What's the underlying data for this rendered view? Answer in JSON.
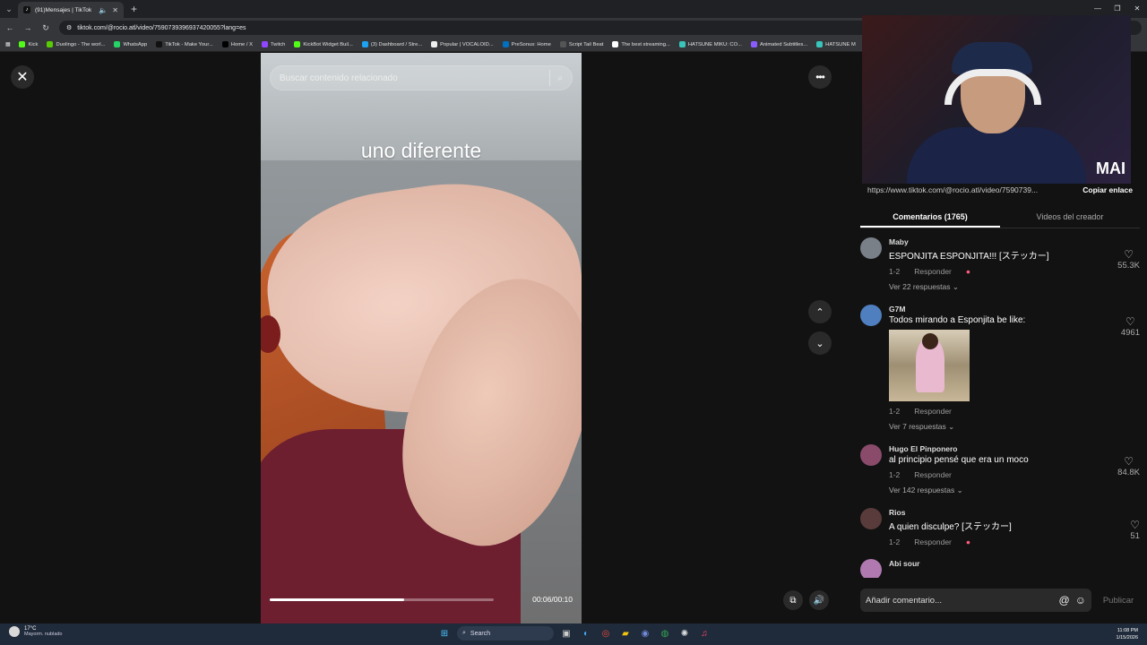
{
  "browser": {
    "tab_title": "(91)Mensajes | TikTok",
    "url": "tiktok.com/@rocio.atl/video/7590739396937420055?lang=es",
    "bookmarks": [
      "Kick",
      "Duolingo - The worl...",
      "WhatsApp",
      "TikTok - Make Your...",
      "Home / X",
      "Twitch",
      "KickBot Widget Buil...",
      "(3) Dashboard / Stre...",
      "Popular | VOCALOID...",
      "PreSonus: Home",
      "Script Tail Beat",
      "The best streaming...",
      "HATSUNE MIKU: CO...",
      "Animated Subtitles...",
      "HATSUNE M"
    ]
  },
  "video": {
    "search_placeholder": "Buscar contenido relacionado",
    "caption": "uno diferente",
    "time": "00:06/00:10",
    "progress": 0.6
  },
  "panel": {
    "link": "https://www.tiktok.com/@rocio.atl/video/7590739...",
    "copy_label": "Copiar enlace",
    "webcam_logo": "MAI",
    "tabs": [
      "Comentarios (1765)",
      "Videos del creador"
    ]
  },
  "comments": [
    {
      "name": "Maby",
      "text": "ESPONJITA ESPONJITA!!! [ステッカー]",
      "date": "1-2",
      "reply": "Responder",
      "replies": "Ver 22 respuestas",
      "likes": "55.3K",
      "avatar_color": "#7a8088"
    },
    {
      "name": "G7M",
      "text": "Todos mirando a Esponjita be like:",
      "date": "1-2",
      "reply": "Responder",
      "replies": "Ver 7 respuestas",
      "likes": "4961",
      "avatar_color": "#4f7fbf"
    },
    {
      "name": "Hugo El Pinponero",
      "text": "al principio pensé que era un moco",
      "date": "1-2",
      "reply": "Responder",
      "replies": "Ver 142 respuestas",
      "likes": "84.8K",
      "avatar_color": "#8a4b6b"
    },
    {
      "name": "Rios",
      "text": "A quien disculpe? [ステッカー]",
      "date": "1-2",
      "reply": "Responder",
      "replies": "",
      "likes": "51",
      "avatar_color": "#5a3b3b"
    },
    {
      "name": "Abi sour",
      "text": "",
      "date": "",
      "reply": "",
      "replies": "",
      "likes": "",
      "avatar_color": "#b07ab0"
    }
  ],
  "composer": {
    "placeholder": "Añadir comentario...",
    "publish": "Publicar"
  },
  "taskbar": {
    "temp": "17°C",
    "weather": "Mayorm. nublado",
    "search": "Search",
    "time": "11:08 PM",
    "date": "1/15/2026"
  }
}
